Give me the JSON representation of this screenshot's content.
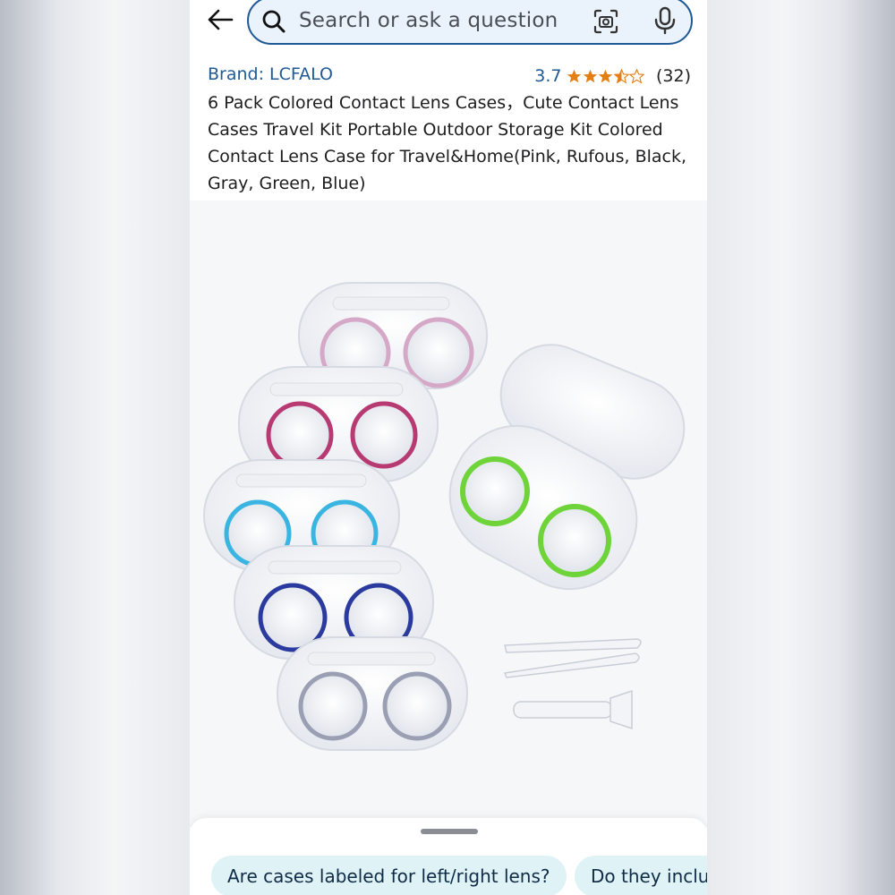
{
  "search": {
    "placeholder": "Search or ask a question",
    "back_icon": "back-arrow-icon",
    "camera_icon": "camera-scan-icon",
    "mic_icon": "microphone-icon"
  },
  "product": {
    "brand": "Brand: LCFALO",
    "rating_value": "3.7",
    "rating_stars": 3.5,
    "rating_count": "(32)",
    "title": "6 Pack Colored Contact Lens Cases，Cute Contact Lens Cases Travel Kit Portable Outdoor Storage Kit Colored Contact Lens Case for Travel&Home(Pink, Rufous, Black, Gray, Green, Blue)"
  },
  "questions": {
    "chip_1": "Are cases labeled for left/right lens?",
    "chip_2": "Do they inclu"
  },
  "colors": {
    "brand_blue": "#1f5a96",
    "star_orange": "#e37f14",
    "chip_bg": "#dff3f6"
  }
}
